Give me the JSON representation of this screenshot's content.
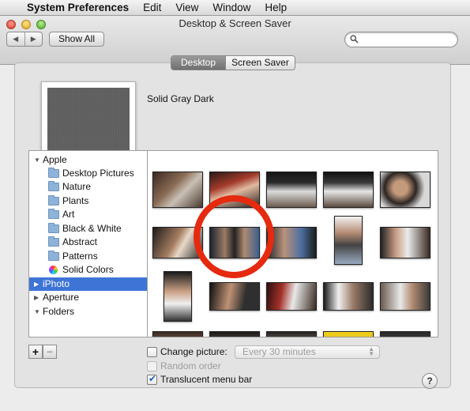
{
  "menubar": {
    "apple_icon": "apple-icon",
    "app_name": "System Preferences",
    "items": [
      "Edit",
      "View",
      "Window",
      "Help"
    ]
  },
  "window": {
    "title": "Desktop & Screen Saver",
    "back_icon": "◀",
    "forward_icon": "▶",
    "show_all_label": "Show All",
    "search_placeholder": ""
  },
  "tabs": [
    {
      "label": "Desktop",
      "active": true
    },
    {
      "label": "Screen Saver",
      "active": false
    }
  ],
  "preview": {
    "name": "Solid Gray Dark",
    "color": "#5d5d5d"
  },
  "sidebar": {
    "items": [
      {
        "label": "Apple",
        "disclosure": "▼",
        "level": 0,
        "icon": "none"
      },
      {
        "label": "Desktop Pictures",
        "level": 1,
        "icon": "folder-icon"
      },
      {
        "label": "Nature",
        "level": 1,
        "icon": "folder-icon"
      },
      {
        "label": "Plants",
        "level": 1,
        "icon": "folder-icon"
      },
      {
        "label": "Art",
        "level": 1,
        "icon": "folder-icon"
      },
      {
        "label": "Black & White",
        "level": 1,
        "icon": "folder-icon"
      },
      {
        "label": "Abstract",
        "level": 1,
        "icon": "folder-icon"
      },
      {
        "label": "Patterns",
        "level": 1,
        "icon": "folder-icon"
      },
      {
        "label": "Solid Colors",
        "level": 1,
        "icon": "color-wheel-icon"
      },
      {
        "label": "iPhoto",
        "disclosure": "▶",
        "level": 0,
        "icon": "none",
        "selected": true
      },
      {
        "label": "Aperture",
        "disclosure": "▶",
        "level": 0,
        "icon": "none"
      },
      {
        "label": "Folders",
        "disclosure": "▼",
        "level": 0,
        "icon": "none"
      }
    ]
  },
  "bottom": {
    "add_label": "+",
    "remove_label": "−",
    "change_picture_label": "Change picture:",
    "change_picture_checked": false,
    "interval_value": "Every 30 minutes",
    "random_order_label": "Random order",
    "random_order_checked": false,
    "translucent_label": "Translucent menu bar",
    "translucent_checked": true,
    "help_label": "?"
  },
  "colors": {
    "selection": "#3e74d6",
    "annotation_circle": "#e52a10"
  }
}
